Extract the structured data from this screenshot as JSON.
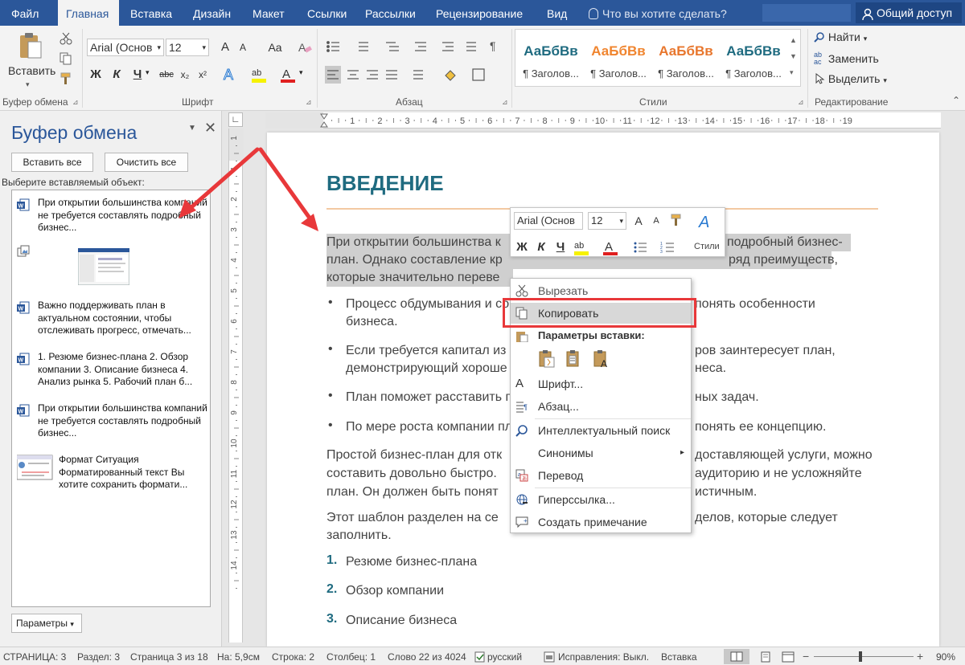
{
  "tabs": [
    "Файл",
    "Главная",
    "Вставка",
    "Дизайн",
    "Макет",
    "Ссылки",
    "Рассылки",
    "Рецензирование",
    "Вид"
  ],
  "tell_me": "Что вы хотите сделать?",
  "share": "Общий доступ",
  "ribbon": {
    "clipboard": {
      "paste": "Вставить",
      "label": "Буфер обмена"
    },
    "font": {
      "name": "Arial (Основ",
      "size": "12",
      "label": "Шрифт",
      "bold": "Ж",
      "italic": "К",
      "underline": "Ч",
      "strike": "abc",
      "sub": "x₂",
      "sup": "x²",
      "grow": "A",
      "shrink": "A",
      "case": "Aa"
    },
    "paragraph": {
      "label": "Абзац"
    },
    "styles": {
      "label": "Стили",
      "items": [
        {
          "sample": "АаБбВв",
          "name": "¶ Заголов...",
          "color": "#1f6b80"
        },
        {
          "sample": "АаБбВв",
          "name": "¶ Заголов...",
          "color": "#f0852f"
        },
        {
          "sample": "АаБбВв",
          "name": "¶ Заголов...",
          "color": "#e8772e"
        },
        {
          "sample": "АаБбВв",
          "name": "¶ Заголов...",
          "color": "#1f6b80"
        }
      ]
    },
    "editing": {
      "find": "Найти",
      "replace": "Заменить",
      "select": "Выделить",
      "label": "Редактирование"
    }
  },
  "pane": {
    "title": "Буфер обмена",
    "paste_all": "Вставить все",
    "clear_all": "Очистить все",
    "choose": "Выберите вставляемый объект:",
    "items": [
      "При открытии большинства компаний не требуется составлять подробный бизнес...",
      "Важно поддерживать план в актуальном состоянии, чтобы отслеживать прогресс, отмечать...",
      "1. Резюме бизнес-плана 2. Обзор компании 3. Описание бизнеса 4. Анализ рынка 5. Рабочий план б...",
      "При открытии большинства компаний не требуется составлять подробный бизнес...",
      "Формат Ситуация Форматированный текст Вы хотите сохранить формати..."
    ],
    "params": "Параметры"
  },
  "doc": {
    "heading": "ВВЕДЕНИЕ",
    "p1_l1a": "При открытии большинства к",
    "p1_l1b": "подробный бизнес-",
    "p1_l2a": "план. Однако составление кр",
    "p1_l2b": "ряд преимуществ,",
    "p1_l3": "которые значительно переве",
    "bullets": [
      {
        "a": "Процесс обдумывания и со",
        "b": "понять особенности",
        "c": "бизнеса."
      },
      {
        "a": "Если требуется капитал из",
        "b": "ров заинтересует план,",
        "c": "демонстрирующий хороше",
        "d": "неса."
      },
      {
        "a": "План поможет расставить п",
        "b": "ных задач."
      },
      {
        "a": "По мере роста компании пл",
        "b": "понять ее концепцию."
      }
    ],
    "p2_l1a": "Простой бизнес-план для отк",
    "p2_l1b": "доставляющей услуги, можно",
    "p2_l2a": "составить довольно быстро.",
    "p2_l2b": "аудиторию и не усложняйте",
    "p2_l3a": "план. Он должен быть понят",
    "p2_l3b": "истичным.",
    "p3_l1a": "Этот шаблон разделен на се",
    "p3_l1b": "делов, которые следует",
    "p3_l2": "заполнить.",
    "numbered": [
      {
        "n": "1.",
        "t": "Резюме бизнес-плана"
      },
      {
        "n": "2.",
        "t": "Обзор компании"
      },
      {
        "n": "3.",
        "t": "Описание бизнеса"
      }
    ]
  },
  "mini": {
    "font": "Arial (Основ",
    "size": "12",
    "styles": "Стили",
    "bold": "Ж",
    "italic": "К",
    "underline": "Ч"
  },
  "context_menu": {
    "cut": "Вырезать",
    "copy": "Копировать",
    "paste_options": "Параметры вставки:",
    "font": "Шрифт...",
    "paragraph": "Абзац...",
    "smart_lookup": "Интеллектуальный поиск",
    "synonyms": "Синонимы",
    "translate": "Перевод",
    "hyperlink": "Гиперссылка...",
    "comment": "Создать примечание"
  },
  "status": {
    "page": "СТРАНИЦА: 3",
    "section": "Раздел: 3",
    "page_of": "Страница 3 из 18",
    "at": "На: 5,9см",
    "line": "Строка: 2",
    "column": "Столбец: 1",
    "words": "Слово 22 из 4024",
    "lang": "русский",
    "track": "Исправления: Выкл.",
    "insert": "Вставка",
    "zoom": "90%"
  },
  "ruler_numbers": [
    "1",
    "2",
    "3",
    "4",
    "5",
    "6",
    "7",
    "8",
    "9",
    "10",
    "11",
    "12",
    "13",
    "14",
    "15",
    "16",
    "17",
    "18",
    "19"
  ],
  "vruler_numbers": [
    "1",
    "1",
    "2",
    "3",
    "4",
    "5",
    "6",
    "7",
    "8",
    "9",
    "10",
    "11",
    "12",
    "13",
    "14"
  ],
  "colors": {
    "word_blue": "#2b579a",
    "heading": "#1f6b80",
    "arrow": "#e8383a",
    "highlight": "#cfcfcf",
    "menu_box": "#e8383a"
  }
}
